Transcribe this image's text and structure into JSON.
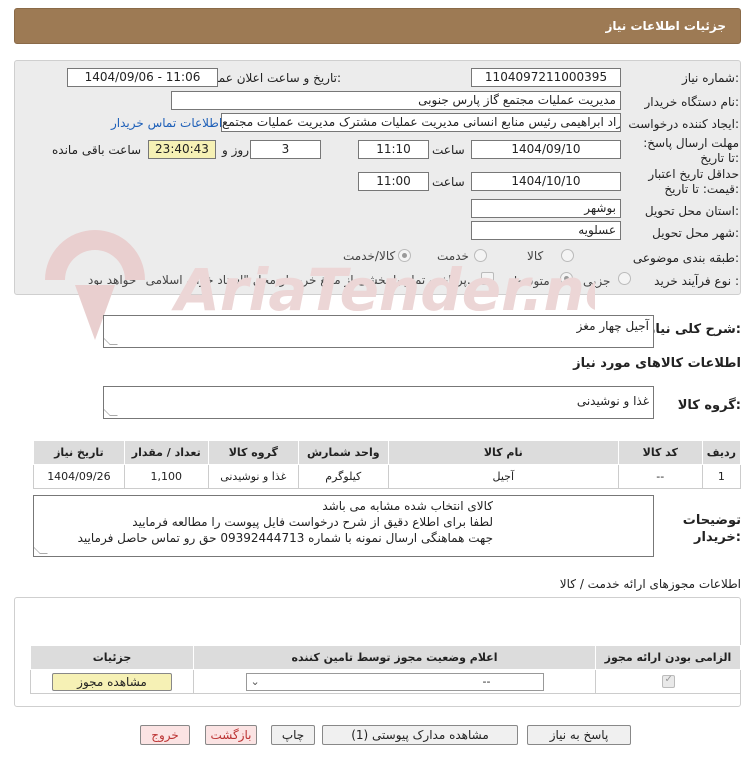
{
  "header": {
    "title": "جزئیات اطلاعات نیاز"
  },
  "need_number": {
    "label": "شماره نیاز:",
    "value": "1104097211000395"
  },
  "announce": {
    "label": "تاریخ و ساعت اعلان عمومی:",
    "value": "1404/09/06 - 11:06"
  },
  "buyer": {
    "label": "نام دستگاه خریدار:",
    "value": "مدیریت عملیات مجتمع گاز پارس جنوبی"
  },
  "creator": {
    "label": "ایجاد کننده درخواست:",
    "value": "بهزاد ابراهیمی رئیس منابع انسانی مدیریت عملیات مشترک  مدیریت عملیات مجتمع",
    "contact_link": "اطلاعات تماس خریدار"
  },
  "deadline": {
    "label": "مهلت ارسال پاسخ: تا تاریخ:",
    "date": "1404/09/10",
    "time_label": "ساعت",
    "time": "11:10",
    "days": "3",
    "days_label": "روز و",
    "remaining": "23:40:43",
    "remaining_label": "ساعت باقی مانده"
  },
  "validity": {
    "label": "حداقل تاریخ اعتبار قیمت: تا تاریخ:",
    "date": "1404/10/10",
    "time_label": "ساعت",
    "time": "11:00"
  },
  "province": {
    "label": "استان محل تحویل:",
    "value": "بوشهر"
  },
  "city": {
    "label": "شهر محل تحویل:",
    "value": "عسلویه"
  },
  "category": {
    "label": "طبقه بندی موضوعی:",
    "options": [
      "کالا",
      "خدمت",
      "کالا/خدمت"
    ]
  },
  "process": {
    "label": "نوع فرآیند خرید :",
    "options": [
      "جزیی",
      "متوسط"
    ],
    "note": "پرداخت تمام یا بخشی از مبلغ خرید،از محل \"اسناد خزانه اسلامی\" خواهد بود."
  },
  "summary": {
    "label": "شرح کلی نیاز:",
    "value": "آجیل چهار مغز"
  },
  "goods_info": {
    "label": "اطلاعات کالاهای مورد نیاز"
  },
  "goods_group": {
    "label": "گروه کالا:",
    "value": "غذا و نوشیدنی"
  },
  "goods_table": {
    "headers": [
      "ردیف",
      "کد کالا",
      "نام کالا",
      "واحد شمارش",
      "گروه کالا",
      "تعداد / مقدار",
      "تاریخ نیاز"
    ],
    "rows": [
      [
        "1",
        "--",
        "آجیل",
        "کیلوگرم",
        "غذا و نوشیدنی",
        "1,100",
        "1404/09/26"
      ]
    ]
  },
  "buyer_notes": {
    "label": "توضیحات خریدار:",
    "lines": [
      "کالای انتخاب شده مشابه می باشد",
      "لطفا برای اطلاع دقیق از شرح درخواست فایل پیوست را مطالعه فرمایید",
      "جهت هماهنگی ارسال نمونه با شماره 09392444713 حق رو تماس حاصل فرمایید"
    ]
  },
  "permits": {
    "title": "اطلاعات مجوزهای ارائه خدمت / کالا",
    "headers": [
      "الزامی بودن ارائه مجوز",
      "اعلام وضعیت مجوز توسط تامین کننده",
      "جزئیات"
    ],
    "select_value": "--",
    "view_button": "مشاهده مجوز"
  },
  "buttons": {
    "reply": "پاسخ به نیاز",
    "attachments": "مشاهده مدارک پیوستی (1)",
    "print": "چاپ",
    "back": "بازگشت",
    "exit": "خروج"
  },
  "watermark": {
    "text": "AriaTender.neT"
  },
  "colors": {
    "header": "#9d7a54",
    "link": "#1d5fb8",
    "yellow": "#f6f1b5",
    "watermark": "#e6c9c9"
  }
}
